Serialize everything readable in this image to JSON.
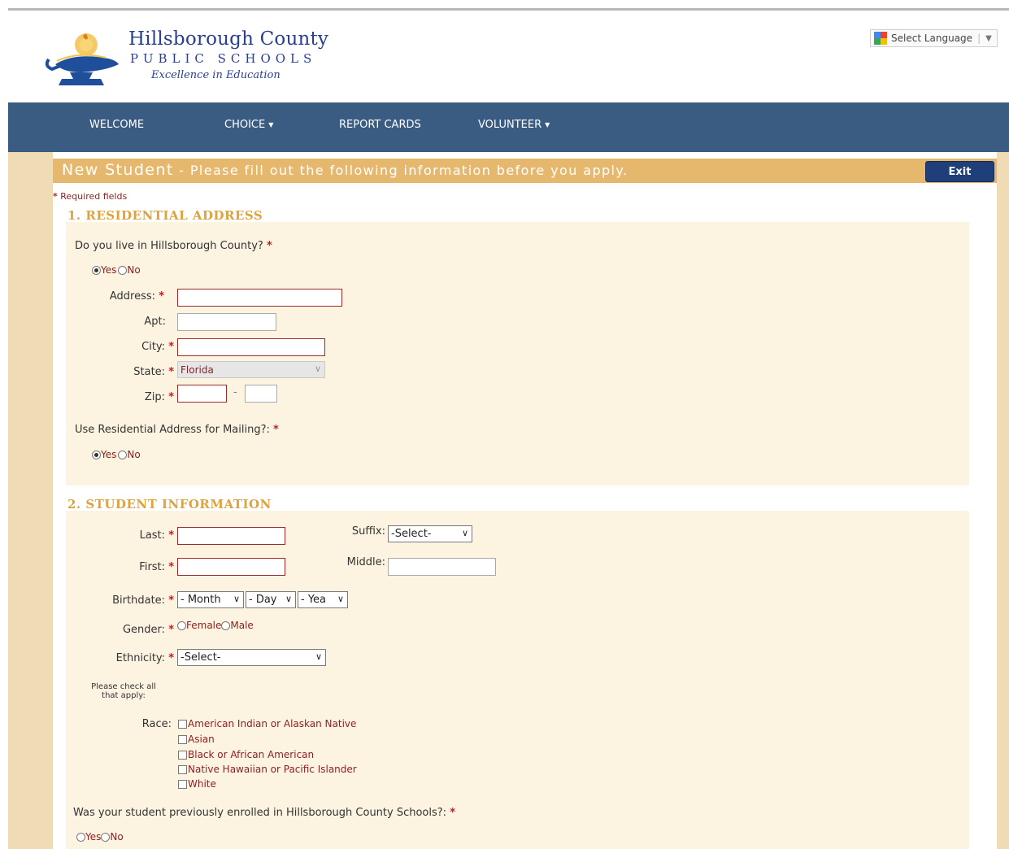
{
  "header": {
    "logo_title": "Hillsborough County",
    "logo_subtitle": "PUBLIC SCHOOLS",
    "logo_tagline": "Excellence in Education",
    "language_label": "Select Language"
  },
  "nav": {
    "items": [
      {
        "label": "WELCOME",
        "dropdown": false
      },
      {
        "label": "CHOICE",
        "dropdown": true
      },
      {
        "label": "REPORT CARDS",
        "dropdown": false
      },
      {
        "label": "VOLUNTEER",
        "dropdown": true
      }
    ]
  },
  "banner": {
    "title": "New Student",
    "subtitle": " - Please fill out the following information before you apply.",
    "exit_label": "Exit"
  },
  "required_note": "Required fields",
  "section1": {
    "title": "1. RESIDENTIAL ADDRESS",
    "live_question": "Do you live in Hillsborough County?",
    "live_yes": "Yes",
    "live_no": "No",
    "live_selected": "Yes",
    "address_label": "Address:",
    "apt_label": "Apt:",
    "city_label": "City:",
    "state_label": "State:",
    "state_value": "Florida",
    "zip_label": "Zip:",
    "zip_sep": "-",
    "mailing_question": "Use Residential Address for Mailing?:",
    "mailing_yes": "Yes",
    "mailing_no": "No",
    "mailing_selected": "Yes"
  },
  "section2": {
    "title": "2. STUDENT INFORMATION",
    "last_label": "Last:",
    "first_label": "First:",
    "suffix_label": "Suffix:",
    "suffix_value": "-Select-",
    "middle_label": "Middle:",
    "birthdate_label": "Birthdate:",
    "month_value": "- Month",
    "day_value": "- Day",
    "year_value": "- Yea",
    "gender_label": "Gender:",
    "gender_female": "Female",
    "gender_male": "Male",
    "ethnicity_label": "Ethnicity:",
    "ethnicity_value": "-Select-",
    "check_note_1": "Please check all",
    "check_note_2": "that apply:",
    "race_label": "Race:",
    "race_options": [
      "American Indian or Alaskan Native",
      "Asian",
      "Black or African American",
      "Native Hawaiian or Pacific Islander",
      "White"
    ],
    "enrolled_question": "Was your student previously enrolled in Hillsborough County Schools?:",
    "enrolled_yes": "Yes",
    "enrolled_no": "No"
  },
  "colors": {
    "nav_bg": "#3b5c82",
    "banner_bg": "#e6b86d",
    "exit_bg": "#1f3f7a",
    "section_title": "#e0a23a",
    "required_star": "#bb2222"
  }
}
